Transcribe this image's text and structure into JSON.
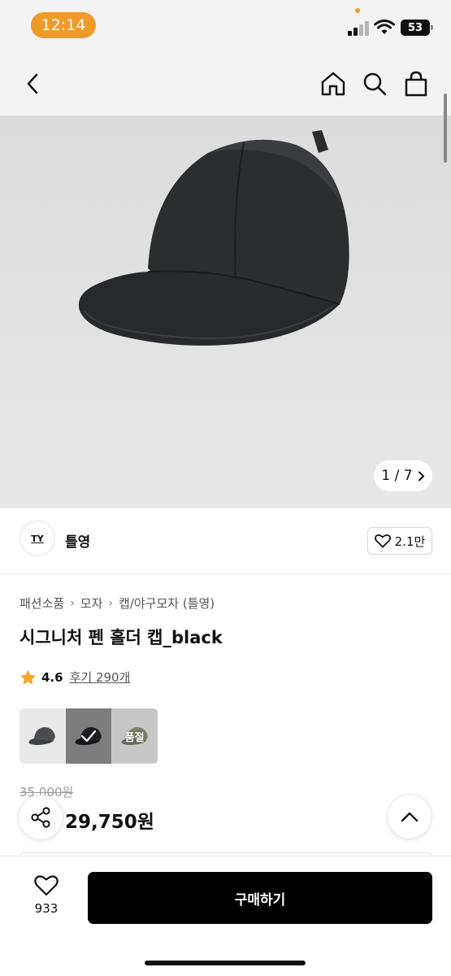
{
  "status_bar": {
    "time": "12:14",
    "battery": "53"
  },
  "nav": {
    "back_icon": "chevron-left-icon",
    "home_icon": "home-icon",
    "search_icon": "search-icon",
    "bag_icon": "shopping-bag-icon"
  },
  "gallery": {
    "counter": "1 / 7"
  },
  "brand": {
    "logo_text": "TY",
    "name": "틀영",
    "likes": "2.1만"
  },
  "breadcrumb": [
    "패션소품",
    "모자",
    "캡/야구모자 (틀영)"
  ],
  "product": {
    "title": "시그니처 펜 홀더 캡_black",
    "rating": "4.6",
    "reviews": "후기 290개"
  },
  "options": {
    "soldout_label": "품절"
  },
  "price": {
    "original": "35,000원",
    "sale": "29,750원"
  },
  "bottom": {
    "wish_count": "933",
    "buy_label": "구매하기"
  },
  "colors": {
    "accent": "#f09a2a",
    "buy": "#000000",
    "star": "#f5a623"
  }
}
